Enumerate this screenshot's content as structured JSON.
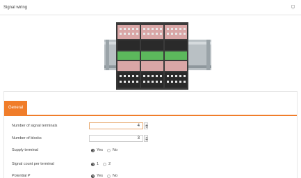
{
  "window": {
    "title": "Signal wiring"
  },
  "tabs": [
    {
      "label": "General",
      "active": true
    }
  ],
  "form": {
    "signal_terminals": {
      "label": "Number of signal terminals",
      "value": "4"
    },
    "blocks": {
      "label": "Number of blocks",
      "value": "3"
    },
    "supply_terminal": {
      "label": "Supply terminal",
      "options": [
        "Yes",
        "No"
      ],
      "selected": "Yes"
    },
    "signal_count": {
      "label": "Signal count per terminal",
      "options": [
        "1",
        "2"
      ],
      "selected": "1"
    },
    "potential": {
      "label": "Potential P",
      "options": [
        "Yes",
        "No"
      ],
      "selected": "Yes"
    }
  },
  "colors": {
    "accent": "#f07d2a",
    "terminal_body": "#3a3a3a",
    "terminal_pink": "#d9a6a6",
    "terminal_green": "#5cb85c",
    "din_rail": "#9aa3a8"
  },
  "icons": {
    "window_action": "pin-icon"
  }
}
